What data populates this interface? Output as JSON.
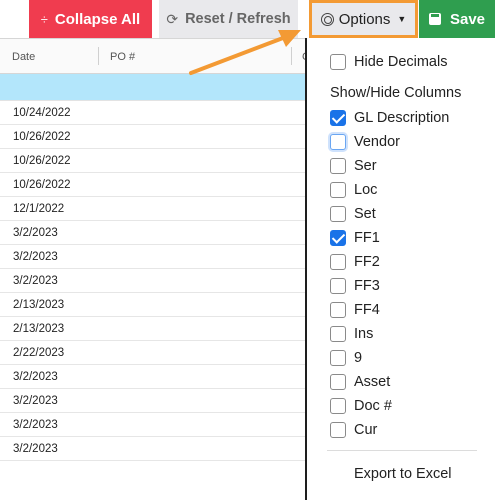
{
  "toolbar": {
    "collapse_label": "Collapse All",
    "reset_label": "Reset / Refresh",
    "options_label": "Options",
    "save_label": "Save"
  },
  "grid": {
    "columns": [
      "Date",
      "PO #",
      "G"
    ],
    "rows": [
      "10/24/2022",
      "10/26/2022",
      "10/26/2022",
      "10/26/2022",
      "12/1/2022",
      "3/2/2023",
      "3/2/2023",
      "3/2/2023",
      "2/13/2023",
      "2/13/2023",
      "2/22/2023",
      "3/2/2023",
      "3/2/2023",
      "3/2/2023",
      "3/2/2023"
    ]
  },
  "options_menu": {
    "hide_decimals": {
      "label": "Hide Decimals",
      "checked": false
    },
    "columns_heading": "Show/Hide Columns",
    "columns": [
      {
        "label": "GL Description",
        "checked": true
      },
      {
        "label": "Vendor",
        "checked": false,
        "focused": true
      },
      {
        "label": "Ser",
        "checked": false
      },
      {
        "label": "Loc",
        "checked": false
      },
      {
        "label": "Set",
        "checked": false
      },
      {
        "label": "FF1",
        "checked": true
      },
      {
        "label": "FF2",
        "checked": false
      },
      {
        "label": "FF3",
        "checked": false
      },
      {
        "label": "FF4",
        "checked": false
      },
      {
        "label": "Ins",
        "checked": false
      },
      {
        "label": "9",
        "checked": false
      },
      {
        "label": "Asset",
        "checked": false
      },
      {
        "label": "Doc #",
        "checked": false
      },
      {
        "label": "Cur",
        "checked": false
      }
    ],
    "export_label": "Export to Excel"
  },
  "colors": {
    "collapse": "#f03c4f",
    "save": "#2f9e4f",
    "highlight": "#f39a34",
    "selected_row": "#b3e6fb",
    "checkbox_checked": "#1a73e8"
  },
  "icons": {
    "collapse": "collapse-icon",
    "reset": "refresh-icon",
    "options": "target-icon",
    "save": "save-icon"
  }
}
